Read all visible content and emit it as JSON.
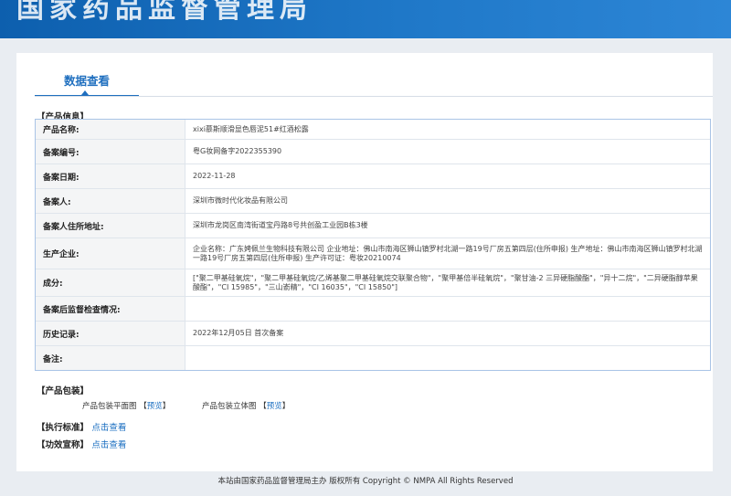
{
  "banner": {
    "title": "国家药品监督管理局"
  },
  "tab": {
    "label": "数据查看"
  },
  "sections": {
    "product_info": "【产品信息】",
    "packaging": "【产品包装】",
    "standard": "【执行标准】",
    "efficacy": "【功效宣称】"
  },
  "rows": [
    {
      "label": "产品名称:",
      "value": "xixi慕斯顺滑显色唇泥51#红酒松露"
    },
    {
      "label": "备案编号:",
      "value": "粤G妆网备字2022355390"
    },
    {
      "label": "备案日期:",
      "value": "2022-11-28"
    },
    {
      "label": "备案人:",
      "value": "深圳市微时代化妆品有限公司"
    },
    {
      "label": "备案人住所地址:",
      "value": "深圳市龙岗区南湾街道宝丹路8号共创盈工业园B栋3楼"
    },
    {
      "label": "生产企业:",
      "value": "企业名称：广东娉佩兰生物科技有限公司 企业地址：佛山市南海区狮山镇罗村北湖一路19号厂房五第四层(住所申报) 生产地址：佛山市南海区狮山镇罗村北湖一路19号厂房五第四层(住所申报) 生产许可证：粤妆20210074"
    },
    {
      "label": "成分:",
      "value": "[\"聚二甲基硅氧烷\"，\"聚二甲基硅氧烷/乙烯基聚二甲基硅氧烷交联聚合物\"，\"聚甲基倍半硅氧烷\"，\"聚甘油-2 三异硬脂酸酯\"，\"异十二烷\"，\"二异硬脂醇苹果酸酯\"，\"CI 15985\"，\"三山嵛精\"，\"CI 16035\"，\"CI 15850\"]"
    },
    {
      "label": "备案后监督检查情况:",
      "value": ""
    },
    {
      "label": "历史记录:",
      "value": "2022年12月05日 首次备案"
    },
    {
      "label": "备注:",
      "value": ""
    }
  ],
  "packaging": {
    "flat_label": "产品包装平面图",
    "flat_link": "预览",
    "stereo_label": "产品包装立体图",
    "stereo_link": "预览",
    "bracket_open": "【",
    "bracket_close": "】"
  },
  "standard_link": "点击查看",
  "efficacy_link": "点击查看",
  "footer": "本站由国家药品监督管理局主办 版权所有 Copyright © NMPA All Rights Reserved"
}
